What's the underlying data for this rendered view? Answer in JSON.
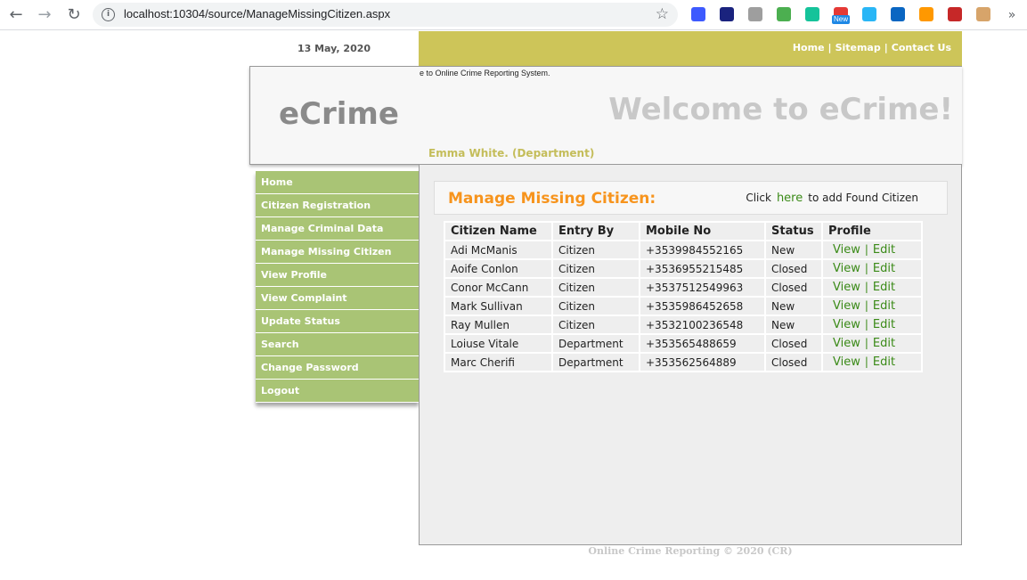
{
  "browser": {
    "url": "localhost:10304/source/ManageMissingCitizen.aspx",
    "back_icon": "←",
    "forward_icon": "→",
    "reload_icon": "↻",
    "star_icon": "☆",
    "more_icon": "»",
    "extensions": [
      {
        "name": "rocket-ext-icon",
        "color": "#3d5afe"
      },
      {
        "name": "mouse-ext-icon",
        "color": "#1a237e"
      },
      {
        "name": "shield-ext-icon",
        "color": "#9e9e9e"
      },
      {
        "name": "printer-ext-icon",
        "color": "#4caf50"
      },
      {
        "name": "grammarly-ext-icon",
        "color": "#15c39a"
      },
      {
        "name": "new-ext-icon",
        "color": "#e53935"
      },
      {
        "name": "window-ext-icon",
        "color": "#29b6f6"
      },
      {
        "name": "linkedin-ext-icon",
        "color": "#0a66c2"
      },
      {
        "name": "palette-ext-icon",
        "color": "#ff9800"
      },
      {
        "name": "book-ext-icon",
        "color": "#c62828"
      },
      {
        "name": "face-ext-icon",
        "color": "#d7a46a"
      }
    ],
    "new_badge": "New"
  },
  "header": {
    "date": "13 May, 2020",
    "links": [
      "Home",
      "Sitemap",
      "Contact Us"
    ],
    "separator": "|",
    "marquee": "e to Online Crime Reporting System.",
    "logo": "eCrime",
    "welcome": "Welcome to eCrime!",
    "user": "Emma White. (Department)"
  },
  "menu": [
    "Home",
    "Citizen Registration",
    "Manage Criminal Data",
    "Manage Missing Citizen",
    "View Profile",
    "View Complaint",
    "Update Status",
    "Search",
    "Change Password",
    "Logout"
  ],
  "main": {
    "title": "Manage Missing Citizen:",
    "click_prefix": "Click",
    "click_link": "here",
    "click_suffix": "to add Found Citizen",
    "columns": [
      "Citizen Name",
      "Entry By",
      "Mobile No",
      "Status",
      "Profile"
    ],
    "rows": [
      {
        "name": "Adi McManis",
        "entry_by": "Citizen",
        "mobile": "+3539984552165",
        "status": "New"
      },
      {
        "name": "Aoife Conlon",
        "entry_by": "Citizen",
        "mobile": "+3536955215485",
        "status": "Closed"
      },
      {
        "name": "Conor McCann",
        "entry_by": "Citizen",
        "mobile": "+3537512549963",
        "status": "Closed"
      },
      {
        "name": "Mark Sullivan",
        "entry_by": "Citizen",
        "mobile": "+3535986452658",
        "status": "New"
      },
      {
        "name": "Ray Mullen",
        "entry_by": "Citizen",
        "mobile": "+3532100236548",
        "status": "New"
      },
      {
        "name": "Loiuse Vitale",
        "entry_by": "Department",
        "mobile": "+353565488659",
        "status": "Closed"
      },
      {
        "name": "Marc Cherifi",
        "entry_by": "Department",
        "mobile": "+353562564889",
        "status": "Closed"
      }
    ],
    "view_label": "View",
    "edit_label": "Edit",
    "action_separator": "|"
  },
  "footer": "Online Crime Reporting © 2020 (CR)",
  "colors": {
    "topbar": "#cdc559",
    "menu": "#a9c475",
    "title": "#f7941d",
    "link": "#3a8a17"
  }
}
